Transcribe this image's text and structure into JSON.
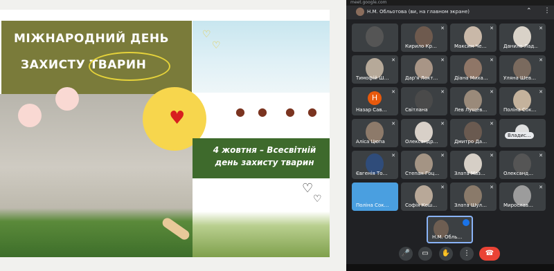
{
  "slide": {
    "title_line1": "МІЖНАРОДНИЙ ДЕНЬ",
    "title_line2": "ЗАХИСТУ ТВАРИН",
    "subtitle": "4 жовтня – Всесвітній день захисту тварин",
    "heart_glyph": "♥",
    "paw_glyph": "🐾",
    "colors": {
      "title_bg": "#7a7b3a",
      "sun": "#f7d64d",
      "heart": "#d81f1f",
      "green_bar": "#3e6a2c"
    }
  },
  "meet": {
    "url": "meet.google.com",
    "header_text": "Н.М. Обльотова (ви, на главном экране)",
    "participants": [
      {
        "name": "",
        "kind": "screen"
      },
      {
        "name": "Кирило Кр…"
      },
      {
        "name": "Максим Че…"
      },
      {
        "name": "Данило Лад…"
      },
      {
        "name": "Тимофій Ш…"
      },
      {
        "name": "Дар'я Локт…"
      },
      {
        "name": "Діана Миха…"
      },
      {
        "name": "Уляна Шев…"
      },
      {
        "name": "Назар Сав…",
        "letter": "Н"
      },
      {
        "name": "Світлана"
      },
      {
        "name": "Лев Лущев…"
      },
      {
        "name": "Поліна Сок…"
      },
      {
        "name": "Аліса Цюпа"
      },
      {
        "name": "Олександр…"
      },
      {
        "name": "Дмитро Да…"
      },
      {
        "name": "Владис…"
      },
      {
        "name": "Євгенія То…"
      },
      {
        "name": "Степан Гоц…"
      },
      {
        "name": "Злата Маз…"
      },
      {
        "name": "Олександ…"
      },
      {
        "name": "Поліна Сок…",
        "kind": "blue"
      },
      {
        "name": "Софія Кош…"
      },
      {
        "name": "Злата Шул…"
      },
      {
        "name": "Мирослав…"
      }
    ],
    "self_tile": {
      "name": "Н.М. Обль…"
    },
    "controls": {
      "mic": "🎤",
      "camera": "▭",
      "hand": "✋",
      "more": "⋮",
      "end_call": "☎"
    },
    "header_icons": {
      "chevron": "⌃",
      "more": "⋮"
    },
    "mic_off": "🔇"
  }
}
